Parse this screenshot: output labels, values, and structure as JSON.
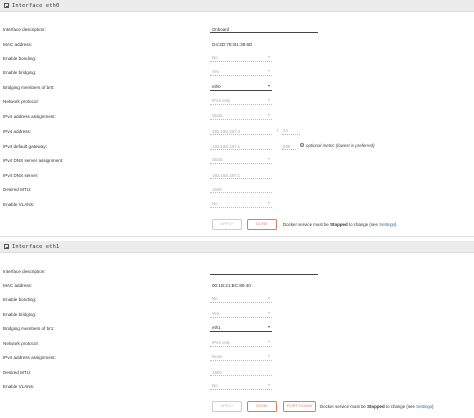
{
  "eth0": {
    "header": "Interface eth0",
    "rows": {
      "description": {
        "label": "Interface description:",
        "value": "Onboard"
      },
      "mac": {
        "label": "MAC address:",
        "value": "D4:3D:7E:B1:39:6D"
      },
      "bonding": {
        "label": "Enable bonding:",
        "value": "No"
      },
      "bridging": {
        "label": "Enable bridging:",
        "value": "Yes"
      },
      "bridge_members": {
        "label": "Bridging members of br0:",
        "value": "eth0"
      },
      "protocol": {
        "label": "Network protocol:",
        "value": "IPv4 only"
      },
      "ipv4_assign": {
        "label": "IPv4 address assignment:",
        "value": "Static"
      },
      "ipv4_address": {
        "label": "IPv4 address:",
        "value": "192.168.187.2",
        "slash": "/",
        "mask": "24"
      },
      "gateway": {
        "label": "IPv4 default gateway:",
        "value": "192.168.187.1",
        "metric": "209",
        "hint": "optional metric (lowest is preferred)",
        "info_icon": "i"
      },
      "dns_assign": {
        "label": "IPv4 DNS server assignment:",
        "value": "Static"
      },
      "dns_server": {
        "label": "IPv4 DNS server:",
        "value": "192.168.187.1"
      },
      "mtu": {
        "label": "Desired MTU:",
        "value": "1500"
      },
      "vlans": {
        "label": "Enable VLANs:",
        "value": "No"
      }
    },
    "buttons": {
      "apply": "APPLY",
      "done": "DONE"
    },
    "note": {
      "prefix": "Docker service must be ",
      "bold": "Stopped",
      "middle": " to change (see ",
      "link": "Settings",
      "suffix": ")"
    }
  },
  "eth1": {
    "header": "Interface eth1",
    "rows": {
      "description": {
        "label": "Interface description:",
        "value": ""
      },
      "mac": {
        "label": "MAC address:",
        "value": "00:1B:21:BC:89:40"
      },
      "bonding": {
        "label": "Enable bonding:",
        "value": "No"
      },
      "bridging": {
        "label": "Enable bridging:",
        "value": "Yes"
      },
      "bridge_members": {
        "label": "Bridging members of br1:",
        "value": "eth1"
      },
      "protocol": {
        "label": "Network protocol:",
        "value": "IPv4 only"
      },
      "ipv4_assign": {
        "label": "IPv4 address assignment:",
        "value": "None"
      },
      "mtu": {
        "label": "Desired MTU:",
        "value": "1500"
      },
      "vlans": {
        "label": "Enable VLANs:",
        "value": "No"
      }
    },
    "buttons": {
      "apply": "APPLY",
      "done": "DONE",
      "port_down": "PORT DOWN"
    },
    "note": {
      "prefix": "Docker service must be ",
      "bold": "Stopped",
      "middle": " to change (see ",
      "link": "Settings",
      "suffix": ")"
    }
  },
  "colors": {
    "accent": "#e8775a",
    "link": "#2b6cb0",
    "header_bg": "#ececec"
  },
  "icons": {
    "collapse": "collapse-toggle-icon",
    "info": "info-icon",
    "caret": "chevron-down-icon"
  }
}
